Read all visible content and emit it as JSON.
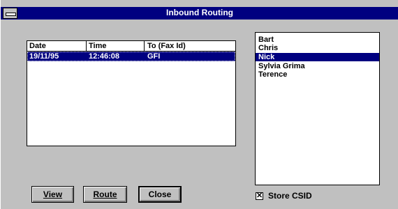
{
  "window": {
    "title": "Inbound Routing"
  },
  "log": {
    "columns": [
      "Date",
      "Time",
      "To (Fax Id)"
    ],
    "rows": [
      {
        "date": "19/11/95",
        "time": "12:46:08",
        "to": "GFI",
        "selected": true
      }
    ]
  },
  "names": {
    "items": [
      "Bart",
      "Chris",
      "Nick",
      "Sylvia  Grima",
      "Terence"
    ],
    "selected_index": 2
  },
  "buttons": {
    "view": "View",
    "route": "Route",
    "close": "Close"
  },
  "store_csid": {
    "label": "Store CSID",
    "checked": true,
    "mark": "✕"
  },
  "colors": {
    "titlebar": "#000080",
    "selection": "#000080",
    "face": "#c0c0c0"
  }
}
